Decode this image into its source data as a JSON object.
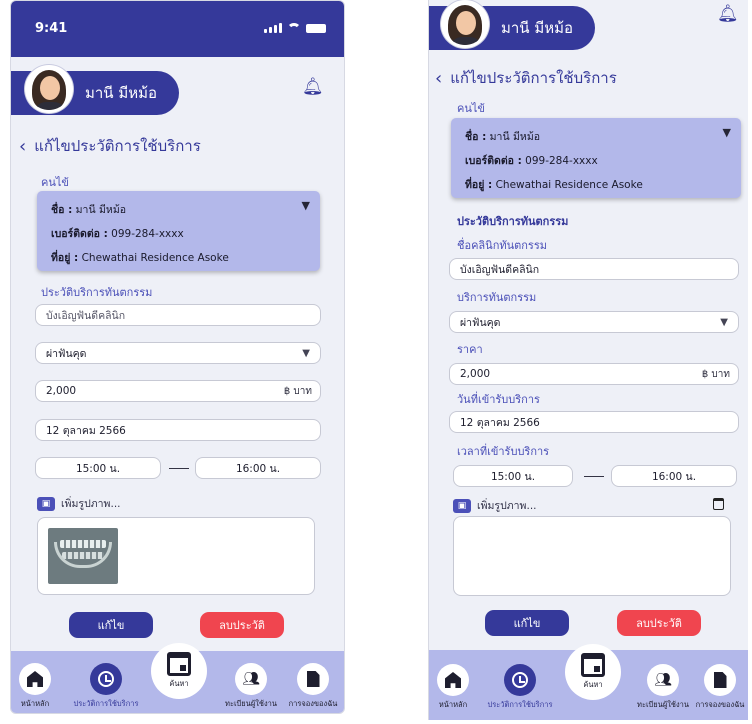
{
  "status_time": "9:41",
  "user_name": "มานี มีหม้อ",
  "page_title": "แก้ไขประวัติการใช้บริการ",
  "patient": {
    "section_label": "คนไข้",
    "name_label": "ชื่อ :",
    "name_value": "มานี มีหม้อ",
    "phone_label": "เบอร์ติดต่อ :",
    "phone_value": "099-284-xxxx",
    "address_label": "ที่อยู่ :",
    "address_value": "Chewathai Residence Asoke"
  },
  "history_label": "ประวัติบริการทันตกรรม",
  "clinic_label": "ชื่อคลินิกทันตกรรม",
  "clinic_value": "บังเอิญฟันดีคลินิก",
  "service_label": "บริการทันตกรรม",
  "service_value": "ผ่าฟันคุด",
  "price_label": "ราคา",
  "price_value": "2,000",
  "price_unit": "฿ บาท",
  "date_label": "วันที่เข้ารับบริการ",
  "date_value": "12 ตุลาคม 2566",
  "time_label": "เวลาที่เข้ารับบริการ",
  "time_start": "15:00 น.",
  "time_end": "16:00 น.",
  "add_photo": "เพิ่มรูปภาพ...",
  "edit_button": "แก้ไข",
  "delete_button": "ลบประวัติ",
  "nav": {
    "home": "หน้าหลัก",
    "history": "ประวัติการใช้บริการ",
    "search": "ค้นหา",
    "register": "ทะเบียนผู้ใช้งาน",
    "bookings": "การจองของฉัน"
  },
  "colors": {
    "primary": "#35399a",
    "card": "#b3b8ea",
    "danger": "#f0454f",
    "background": "#eef0f7"
  },
  "icons": [
    "bell-icon",
    "back-chevron-icon",
    "dropdown-arrow-icon",
    "image-icon",
    "calendar-icon",
    "home-icon",
    "history-icon",
    "calendar-search-icon",
    "users-icon",
    "document-icon"
  ]
}
